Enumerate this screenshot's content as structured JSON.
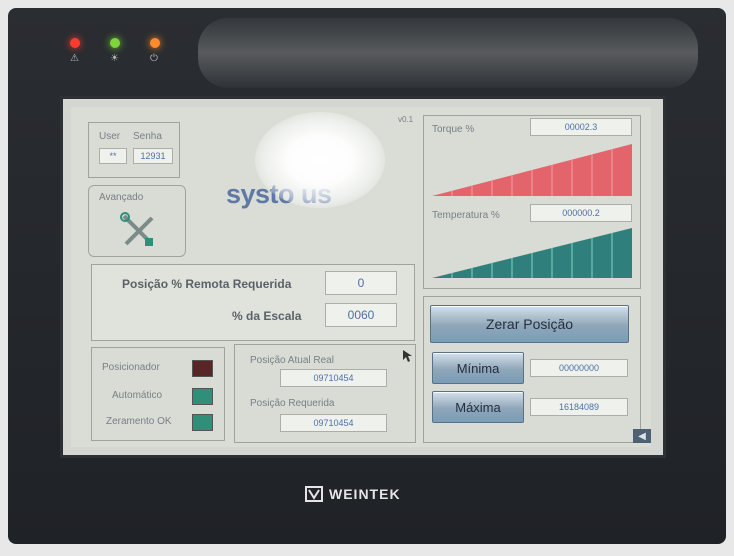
{
  "header": {
    "version": "v0.1"
  },
  "login": {
    "user_label": "User",
    "password_label": "Senha",
    "user_value": "**",
    "password_value": "12931"
  },
  "advanced": {
    "label": "Avançado"
  },
  "logo": {
    "text": "systo  us"
  },
  "remote": {
    "position_label": "Posição % Remota Requerida",
    "position_value": "0",
    "scale_label": "% da Escala",
    "scale_value": "0060"
  },
  "status": {
    "items": [
      {
        "label": "Posicionador",
        "color": "#5a2526"
      },
      {
        "label": "Automático",
        "color": "#2f8f78"
      },
      {
        "label": "Zeramento OK",
        "color": "#2f8f78"
      }
    ]
  },
  "positions": {
    "actual_label": "Posição Atual Real",
    "actual_value": "09710454",
    "required_label": "Posição Requerida",
    "required_value": "09710454"
  },
  "torque": {
    "label": "Torque %",
    "value": "00002.3",
    "color": "#e3646a",
    "level": 1.0
  },
  "temperature": {
    "label": "Temperatura %",
    "value": "000000.2",
    "color": "#2f7f7d",
    "level": 1.0
  },
  "zero_button": {
    "label": "Zerar Posição"
  },
  "min": {
    "label": "Mínima",
    "value": "00000000"
  },
  "max": {
    "label": "Máxima",
    "value": "16184089"
  },
  "brand": {
    "name": "WEINTEK"
  },
  "leds": [
    {
      "icon": "network-icon",
      "color": "#ff3b30"
    },
    {
      "icon": "power-icon",
      "color": "#7cd63a"
    },
    {
      "icon": "cpu-icon",
      "color": "#ff8a2a"
    }
  ]
}
